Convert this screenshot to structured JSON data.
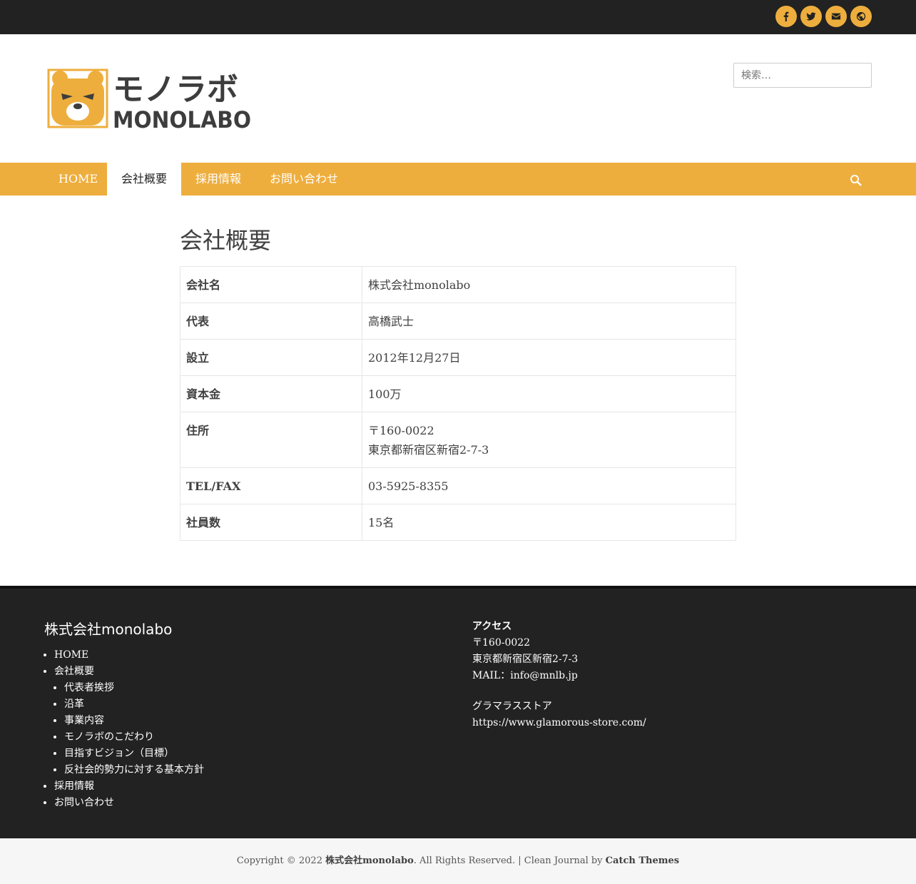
{
  "colors": {
    "accent": "#eeae3d",
    "dark": "#222222"
  },
  "social": [
    {
      "icon": "facebook-icon"
    },
    {
      "icon": "twitter-icon"
    },
    {
      "icon": "mail-icon"
    },
    {
      "icon": "website-icon"
    }
  ],
  "logo": {
    "text_jp": "モノラボ",
    "text_en": "MONOLABO"
  },
  "search": {
    "placeholder": "検索…"
  },
  "nav": {
    "items": [
      "HOME",
      "会社概要",
      "採用情報",
      "お問い合わせ"
    ],
    "active": "会社概要"
  },
  "page": {
    "title": "会社概要",
    "rows": [
      {
        "label": "会社名",
        "value": [
          "株式会社monolabo"
        ]
      },
      {
        "label": "代表",
        "value": [
          "高橋武士"
        ]
      },
      {
        "label": "設立",
        "value": [
          "2012年12月27日"
        ]
      },
      {
        "label": "資本金",
        "value": [
          "100万"
        ]
      },
      {
        "label": "住所",
        "value": [
          "〒160-0022",
          "東京都新宿区新宿2-7-3"
        ]
      },
      {
        "label": "TEL/FAX",
        "value": [
          "03-5925-8355"
        ]
      },
      {
        "label": "社員数",
        "value": [
          "15名"
        ]
      }
    ]
  },
  "footer": {
    "title": "株式会社monolabo",
    "menu": {
      "home": "HOME",
      "company": "会社概要",
      "company_sub": [
        "代表者挨拶",
        "沿革",
        "事業内容",
        "モノラボのこだわり",
        "目指すビジョン（目標）",
        "反社会的勢力に対する基本方針"
      ],
      "recruit": "採用情報",
      "contact": "お問い合わせ"
    },
    "access": {
      "heading": "アクセス",
      "postal": "〒160-0022",
      "address": "東京都新宿区新宿2-7-3",
      "mail": "MAIL：info@mnlb.jp",
      "store_label": "グラマラスストア",
      "store_url": "https://www.glamorous-store.com/"
    }
  },
  "copyright": {
    "prefix": "Copyright © 2022",
    "company": "株式会社monolabo",
    "middle": ". All Rights Reserved. | Clean Journal by",
    "theme": "Catch Themes"
  }
}
